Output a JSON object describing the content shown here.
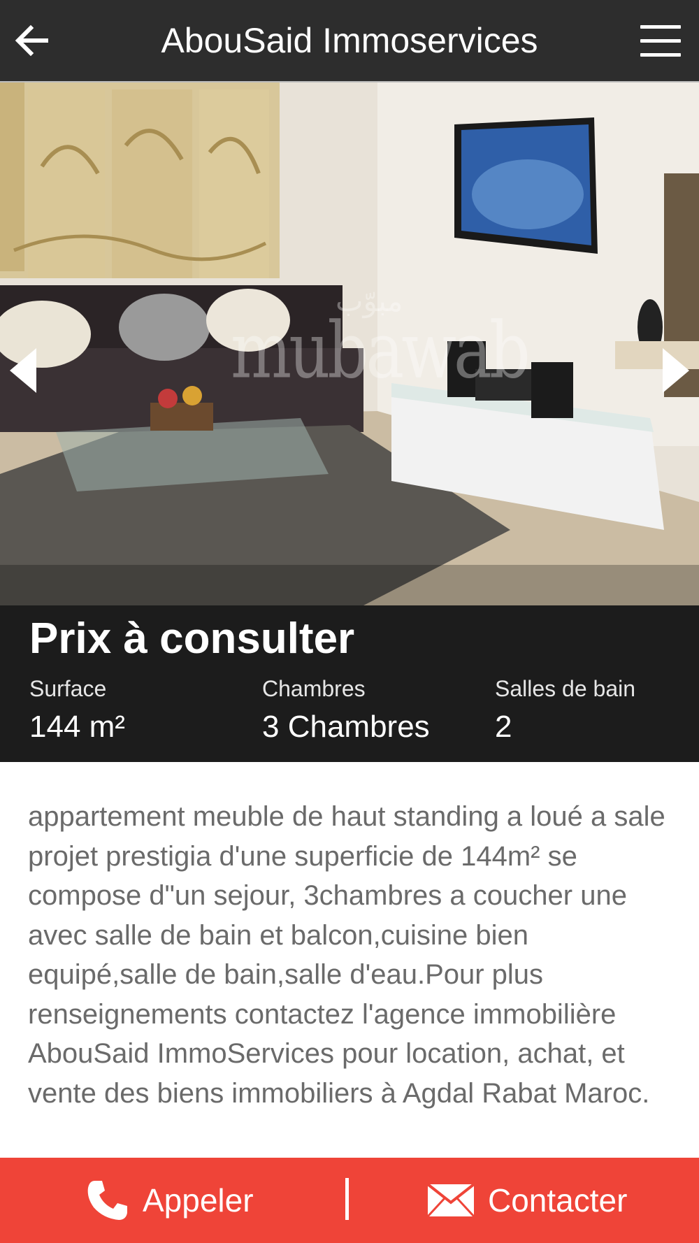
{
  "header": {
    "title": "AbouSaid Immoservices"
  },
  "gallery": {
    "watermark": "mubawab",
    "watermark_ar": "مبوّب"
  },
  "listing": {
    "price": "Prix à consulter",
    "stats": [
      {
        "label": "Surface",
        "value": "144 m²"
      },
      {
        "label": "Chambres",
        "value": "3 Chambres"
      },
      {
        "label": "Salles de bain",
        "value": "2"
      }
    ],
    "description": "appartement meuble de haut standing a loué a sale projet prestigia d'une superficie de 144m² se compose d\"un sejour, 3chambres a coucher une avec salle de bain et balcon,cuisine bien equipé,salle de bain,salle d'eau.Pour plus renseignements contactez l'agence immobilière AbouSaid ImmoServices pour location, achat, et vente des biens immobiliers à Agdal Rabat Maroc."
  },
  "actions": {
    "call_label": "Appeler",
    "contact_label": "Contacter"
  },
  "colors": {
    "header_bg": "#2d2d2d",
    "info_bg": "#1c1c1c",
    "action_bar": "#ef4438",
    "description_text": "#6a6a6a"
  },
  "icons": [
    "back-arrow-icon",
    "hamburger-menu-icon",
    "chevron-left-icon",
    "chevron-right-icon",
    "phone-icon",
    "envelope-icon"
  ]
}
